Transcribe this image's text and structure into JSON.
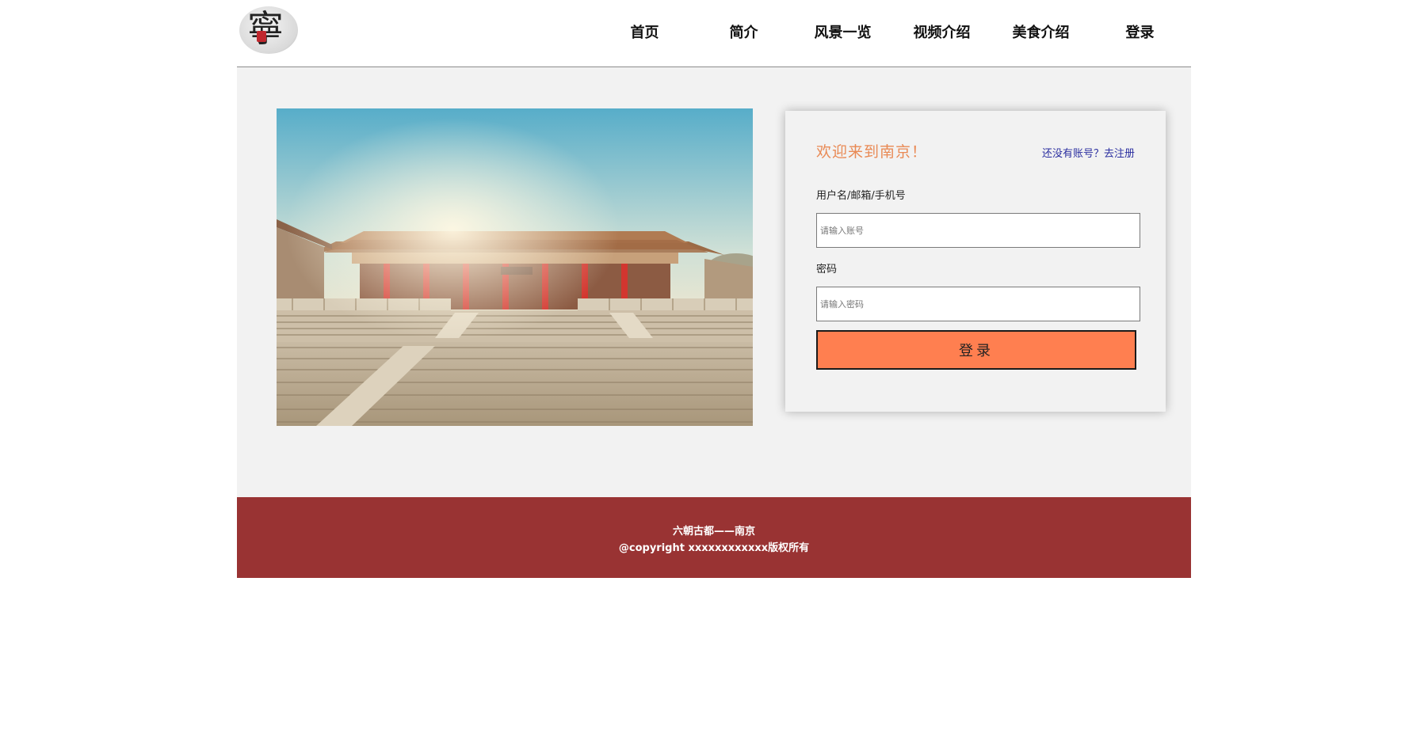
{
  "header": {
    "logo_icon": "nanjing-calligraphy-logo",
    "logo_glyph": "寧",
    "nav": [
      {
        "label": "首页"
      },
      {
        "label": "简介"
      },
      {
        "label": "风景一览"
      },
      {
        "label": "视频介绍"
      },
      {
        "label": "美食介绍"
      },
      {
        "label": "登录"
      }
    ]
  },
  "main": {
    "photo_subject": "nanjing-museum-palace-hall-photo",
    "login": {
      "welcome": "欢迎来到南京！",
      "register_link": "还没有账号？去注册",
      "account_label": "用户名/邮箱/手机号",
      "account_placeholder": "请输入账号",
      "password_label": "密码",
      "password_placeholder": "请输入密码",
      "submit_label": "登录"
    }
  },
  "footer": {
    "line1": "六朝古都——南京",
    "line2": "@copyright xxxxxxxxxxxx版权所有"
  },
  "colors": {
    "main_bg": "#f2f2f2",
    "welcome_text": "#e98a55",
    "register_link": "#2b2fa0",
    "login_button": "#ff7f50",
    "footer_bg": "#993333"
  }
}
